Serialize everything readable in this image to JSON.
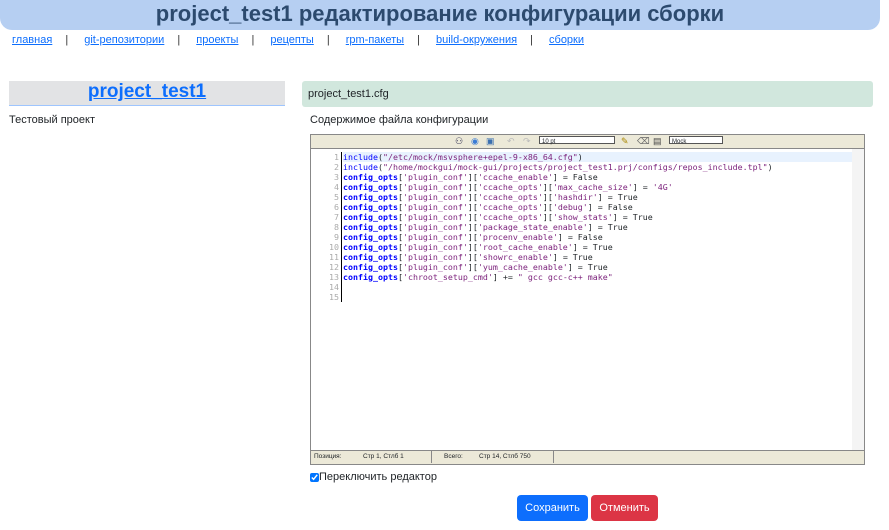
{
  "header": {
    "title": "project_test1 редактирование конфигурации сборки"
  },
  "nav": [
    {
      "label": "главная"
    },
    {
      "label": "git-репозитории"
    },
    {
      "label": "проекты"
    },
    {
      "label": "рецепты"
    },
    {
      "label": "rpm-пакеты"
    },
    {
      "label": "build-окружения"
    },
    {
      "label": "сборки"
    }
  ],
  "nav_separator": "|",
  "project": {
    "name": "project_test1",
    "description": "Тестовый проект"
  },
  "file": {
    "name": "project_test1.cfg",
    "content_label": "Содержимое файла конфигурации"
  },
  "toolbar": {
    "font_size": "10 pt",
    "syntax": "Mock",
    "icons": [
      "search-icon",
      "goto-icon",
      "fullscreen-icon",
      "undo-icon",
      "redo-icon",
      "highlight-icon",
      "reset-icon",
      "help-icon"
    ]
  },
  "code": {
    "line_numbers": [
      "1",
      "2",
      "3",
      "4",
      "5",
      "6",
      "7",
      "8",
      "9",
      "10",
      "11",
      "12",
      "13",
      "14",
      "15"
    ]
  },
  "status": {
    "position_label": "Позиция:",
    "position_value": "Стр 1, Стлб 1",
    "total_label": "Всего:",
    "total_value": "Стр 14, Стлб 750"
  },
  "toggle": {
    "label": "Переключить редактор",
    "checked": true
  },
  "buttons": {
    "save": "Сохранить",
    "cancel": "Отменить"
  },
  "colors": {
    "header": "#b6cff2",
    "save": "#0d6efd",
    "cancel": "#dc3545",
    "file_bar": "#d1e7dd"
  }
}
